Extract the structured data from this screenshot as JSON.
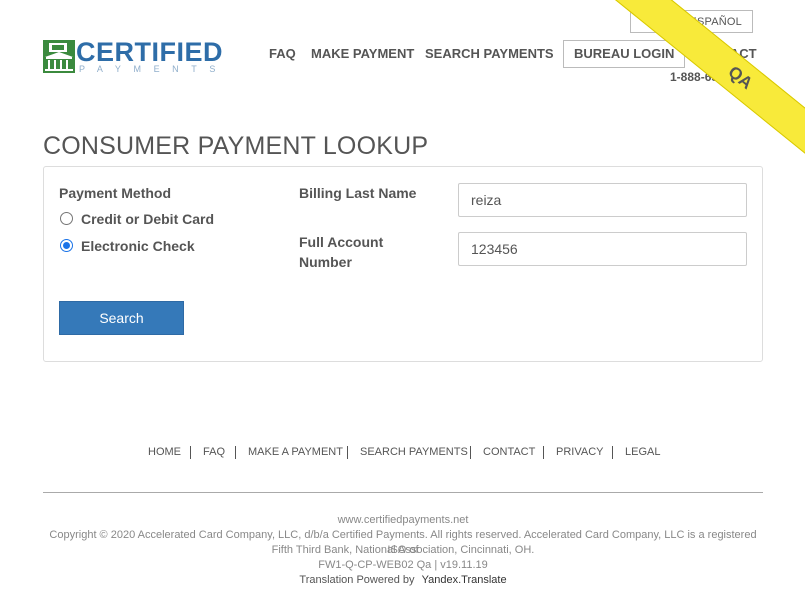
{
  "header": {
    "language_label": "EN ESPAÑOL",
    "logo": {
      "word": "CERTIFIED",
      "sub": "PAYMENTS"
    },
    "nav": [
      "FAQ",
      "MAKE PAYMENT",
      "SEARCH PAYMENTS",
      "BUREAU LOGIN",
      "CONTACT"
    ],
    "phone": "1-888-655-2020",
    "ribbon": "QA"
  },
  "page": {
    "title": "CONSUMER PAYMENT LOOKUP"
  },
  "form": {
    "payment_method_label": "Payment Method",
    "options": [
      "Credit or Debit Card",
      "Electronic Check"
    ],
    "selected_option": "Electronic Check",
    "billing_last_name_label": "Billing Last Name",
    "billing_last_name_value": "reiza",
    "account_number_label_line1": "Full Account",
    "account_number_label_line2": "Number",
    "account_number_value": "123456",
    "search_label": "Search"
  },
  "footer": {
    "links": [
      "HOME",
      "FAQ",
      "MAKE A PAYMENT",
      "SEARCH PAYMENTS",
      "CONTACT",
      "PRIVACY",
      "LEGAL"
    ],
    "site": "www.certifiedpayments.net",
    "copyright_line1": "Copyright © 2020 Accelerated Card Company, LLC, d/b/a Certified Payments. All rights reserved. Accelerated Card Company, LLC is a registered ISO of",
    "copyright_line2": "Fifth Third Bank, National Association, Cincinnati, OH.",
    "version": "FW1-Q-CP-WEB02 Qa | v19.11.19",
    "translation_prefix": "Translation Powered by",
    "translation_service": "Yandex.Translate"
  },
  "colors": {
    "brand_blue": "#2e6da8",
    "logo_green": "#3b8a3e",
    "button_blue": "#3579b9",
    "ribbon_yellow": "#f8ea3a"
  }
}
